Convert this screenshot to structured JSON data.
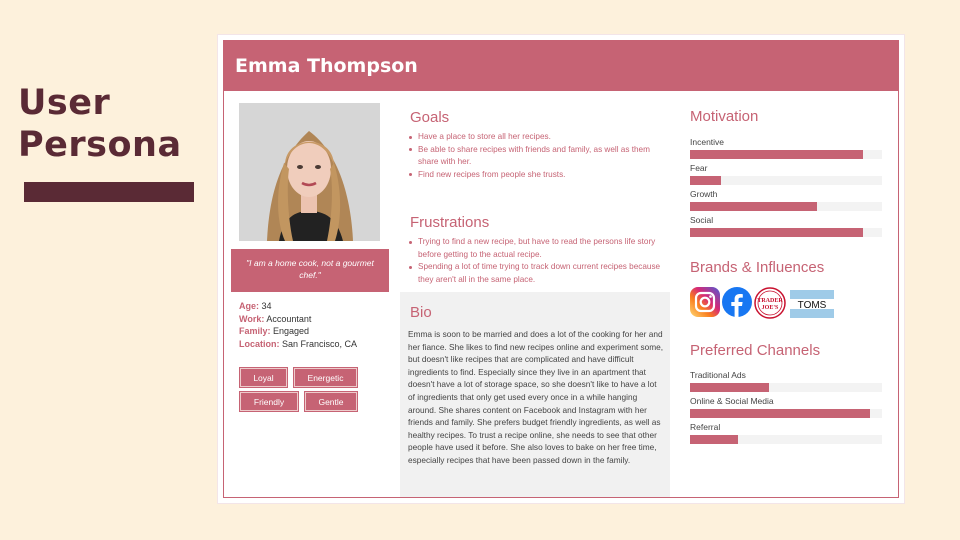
{
  "slide": {
    "title_line1": "User",
    "title_line2": "Persona"
  },
  "persona": {
    "name": "Emma Thompson",
    "quote": "\"I am a home cook, not a gourmet chef.\"",
    "details": [
      {
        "label": "Age:",
        "value": "34"
      },
      {
        "label": "Work:",
        "value": "Accountant"
      },
      {
        "label": "Family:",
        "value": "Engaged"
      },
      {
        "label": "Location:",
        "value": "San Francisco,  CA"
      }
    ],
    "traits": [
      "Loyal",
      "Energetic",
      "Friendly",
      "Gentle"
    ]
  },
  "goals": {
    "title": "Goals",
    "items": [
      "Have a place to store all her recipes.",
      "Be able to share recipes with friends and family, as well as them share with her.",
      "Find new recipes from people she trusts."
    ]
  },
  "frustrations": {
    "title": "Frustrations",
    "items": [
      "Trying to find a new recipe, but have to read the persons life story before getting to the actual recipe.",
      "Spending a lot of time trying to track down current recipes because they aren't all in the same place."
    ]
  },
  "bio": {
    "title": "Bio",
    "text": "Emma is soon to be married and does a lot of the cooking for her and her fiance. She likes to find new recipes online and experiment some, but doesn't like recipes that are complicated and have difficult ingredients to find. Especially since they live in an apartment that doesn't have a lot of storage space, so she doesn't like to have a lot of ingredients that only get used every once in a while hanging around. She shares content on Facebook and Instagram with her friends and family. She prefers budget friendly ingredients, as well as healthy recipes. To trust a recipe online, she needs to see that other people have used it before. She also loves to bake on her free time, especially recipes that have been passed down in the family."
  },
  "motivation": {
    "title": "Motivation",
    "bars": [
      {
        "label": "Incentive",
        "value": 0.9
      },
      {
        "label": "Fear",
        "value": 0.16
      },
      {
        "label": "Growth",
        "value": 0.66
      },
      {
        "label": "Social",
        "value": 0.9
      }
    ]
  },
  "brands": {
    "title": "Brands & Influences",
    "logos": [
      {
        "icon": "instagram-icon"
      },
      {
        "icon": "facebook-icon"
      },
      {
        "icon": "trader-joes-logo",
        "text_line1": "TRADER",
        "text_line2": "JOE'S"
      },
      {
        "icon": "toms-logo",
        "text": "TOMS"
      }
    ]
  },
  "channels": {
    "title": "Preferred Channels",
    "bars": [
      {
        "label": "Traditional Ads",
        "value": 0.41
      },
      {
        "label": "Online & Social Media",
        "value": 0.94
      },
      {
        "label": "Referral",
        "value": 0.25
      }
    ]
  },
  "colors": {
    "accent": "#c66374",
    "dark": "#5a2a35",
    "background": "#fdf1dc"
  }
}
